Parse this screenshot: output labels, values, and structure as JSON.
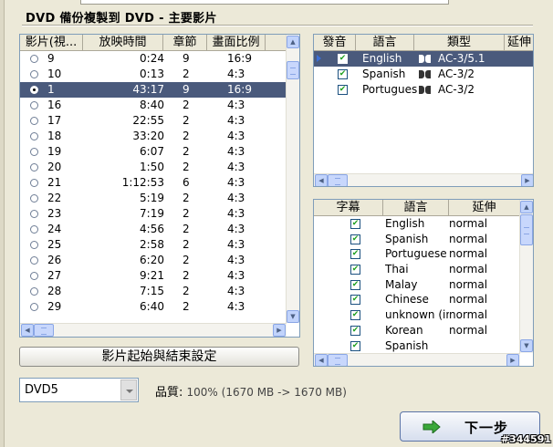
{
  "title": "DVD 備份複製到 DVD - 主要影片",
  "titles_table": {
    "columns": [
      "影片(視...",
      "放映時間",
      "章節",
      "畫面比例"
    ],
    "rows": [
      {
        "no": "9",
        "time": "0:24",
        "chapters": "9",
        "aspect": "16:9",
        "selected": false
      },
      {
        "no": "10",
        "time": "0:13",
        "chapters": "2",
        "aspect": "4:3",
        "selected": false
      },
      {
        "no": "1",
        "time": "43:17",
        "chapters": "9",
        "aspect": "16:9",
        "selected": true
      },
      {
        "no": "16",
        "time": "8:40",
        "chapters": "2",
        "aspect": "4:3",
        "selected": false
      },
      {
        "no": "17",
        "time": "22:55",
        "chapters": "2",
        "aspect": "4:3",
        "selected": false
      },
      {
        "no": "18",
        "time": "33:20",
        "chapters": "2",
        "aspect": "4:3",
        "selected": false
      },
      {
        "no": "19",
        "time": "6:07",
        "chapters": "2",
        "aspect": "4:3",
        "selected": false
      },
      {
        "no": "20",
        "time": "1:50",
        "chapters": "2",
        "aspect": "4:3",
        "selected": false
      },
      {
        "no": "21",
        "time": "1:12:53",
        "chapters": "6",
        "aspect": "4:3",
        "selected": false
      },
      {
        "no": "22",
        "time": "5:19",
        "chapters": "2",
        "aspect": "4:3",
        "selected": false
      },
      {
        "no": "23",
        "time": "7:19",
        "chapters": "2",
        "aspect": "4:3",
        "selected": false
      },
      {
        "no": "24",
        "time": "4:56",
        "chapters": "2",
        "aspect": "4:3",
        "selected": false
      },
      {
        "no": "25",
        "time": "2:58",
        "chapters": "2",
        "aspect": "4:3",
        "selected": false
      },
      {
        "no": "26",
        "time": "6:20",
        "chapters": "2",
        "aspect": "4:3",
        "selected": false
      },
      {
        "no": "27",
        "time": "9:21",
        "chapters": "2",
        "aspect": "4:3",
        "selected": false
      },
      {
        "no": "28",
        "time": "7:15",
        "chapters": "2",
        "aspect": "4:3",
        "selected": false
      },
      {
        "no": "29",
        "time": "6:40",
        "chapters": "2",
        "aspect": "4:3",
        "selected": false
      }
    ]
  },
  "audio_table": {
    "columns": [
      "發音",
      "語言",
      "類型",
      "延伸"
    ],
    "rows": [
      {
        "language": "English",
        "type": "AC-3/5.1",
        "checked": true,
        "selected": true
      },
      {
        "language": "Spanish",
        "type": "AC-3/2",
        "checked": true,
        "selected": false
      },
      {
        "language": "Portugues",
        "type": "AC-3/2",
        "checked": true,
        "selected": false
      }
    ]
  },
  "subtitle_table": {
    "columns": [
      "字幕",
      "語言",
      "延伸"
    ],
    "rows": [
      {
        "language": "English",
        "ext": "normal",
        "checked": true
      },
      {
        "language": "Spanish",
        "ext": "normal",
        "checked": true
      },
      {
        "language": "Portuguese",
        "ext": "normal",
        "checked": true
      },
      {
        "language": "Thai",
        "ext": "normal",
        "checked": true
      },
      {
        "language": "Malay",
        "ext": "normal",
        "checked": true
      },
      {
        "language": "Chinese",
        "ext": "normal",
        "checked": true
      },
      {
        "language": "unknown (in",
        "ext": "normal",
        "checked": true
      },
      {
        "language": "Korean",
        "ext": "normal",
        "checked": true
      },
      {
        "language": "Spanish",
        "ext": "",
        "checked": true
      }
    ]
  },
  "start_end_button": "影片起始與結束設定",
  "disc_select": {
    "value": "DVD5"
  },
  "quality": {
    "label": "品質:",
    "value": "100% (1670 MB -> 1670 MB)"
  },
  "next_button": "下一步",
  "watermark": "#344591",
  "colors": {
    "selection": "#4a5a7c",
    "panel_border": "#7f9db9",
    "background": "#ece9d8"
  }
}
